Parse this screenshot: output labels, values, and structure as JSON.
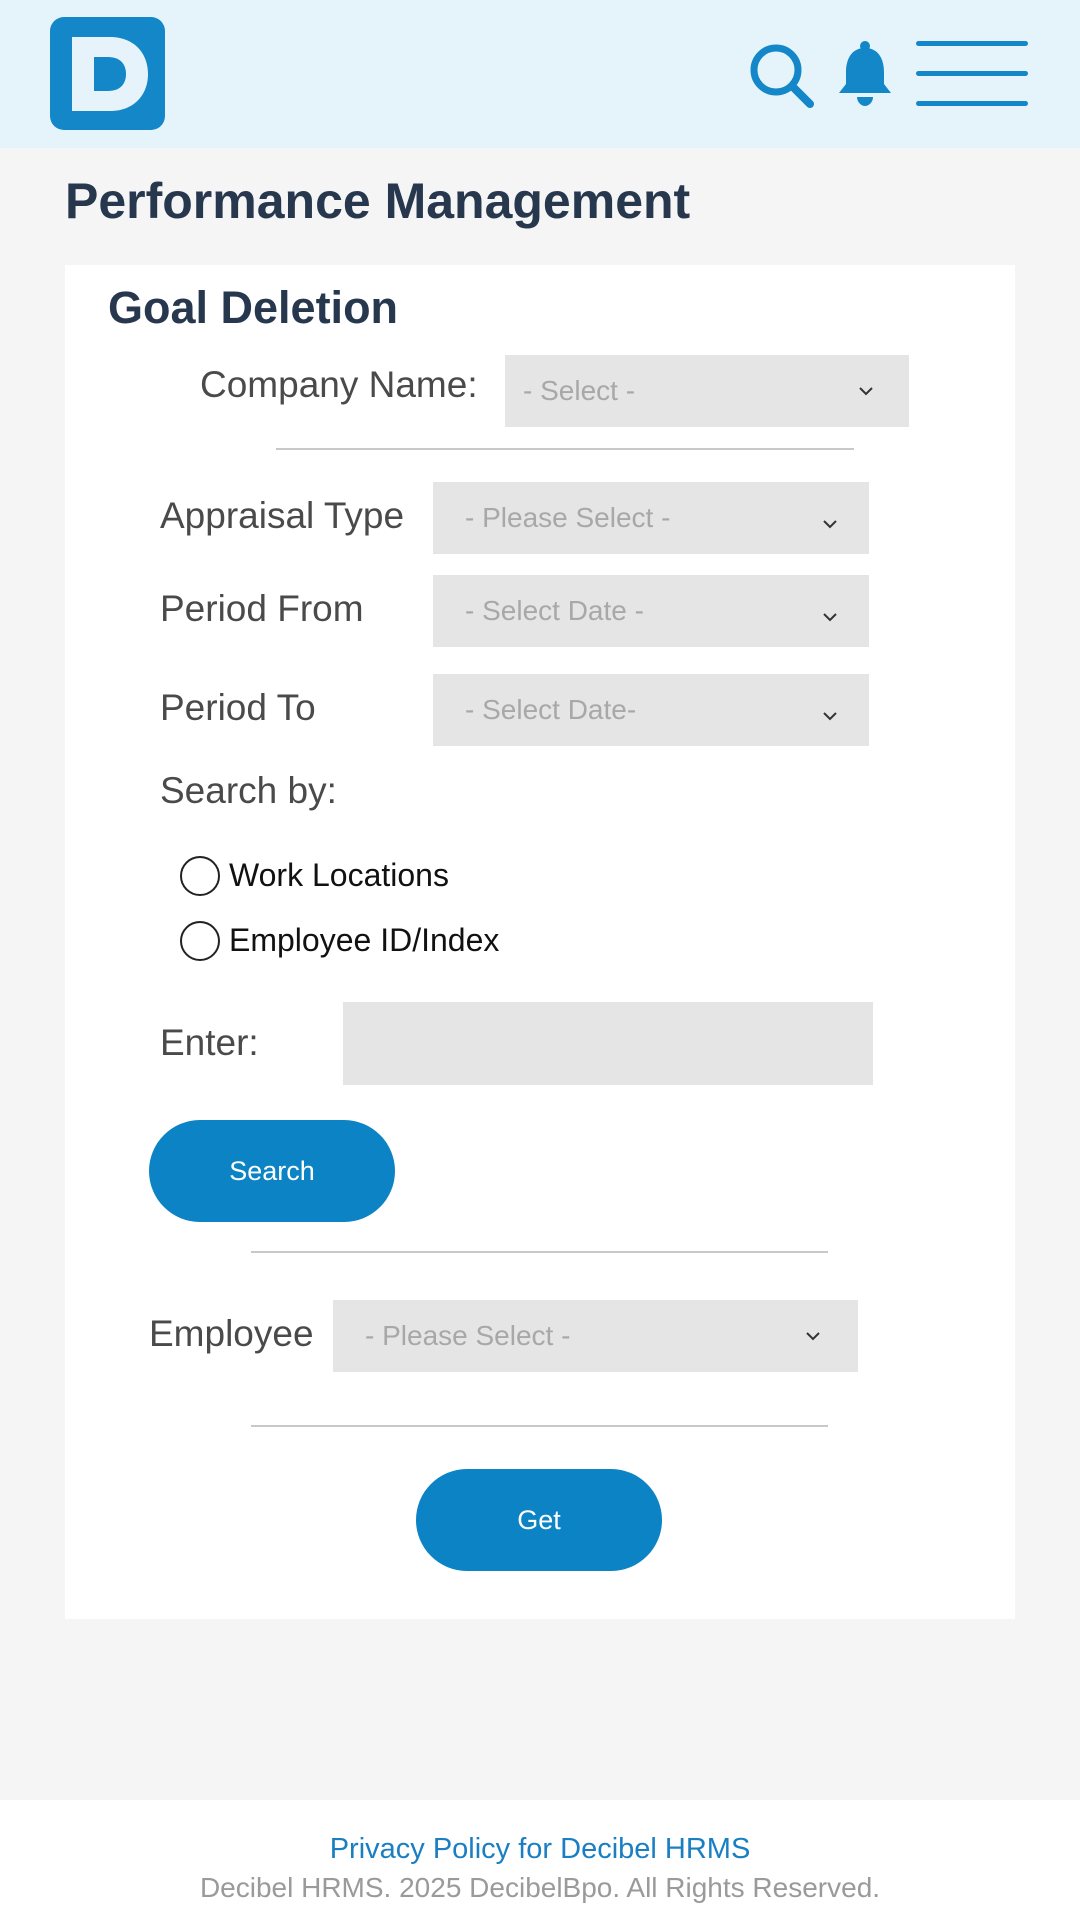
{
  "header": {
    "logo_letter": "D",
    "icons": {
      "logo": "decibel-logo",
      "search": "search-icon",
      "notifications": "bell-icon",
      "menu": "hamburger-menu-icon"
    },
    "accent_color": "#1387c8",
    "background_color": "#e5f3fb"
  },
  "page": {
    "title": "Performance Management"
  },
  "form": {
    "section_title": "Goal Deletion",
    "company": {
      "label": "Company Name:",
      "value": "- Select -"
    },
    "appraisal_type": {
      "label": "Appraisal Type",
      "value": "- Please Select -"
    },
    "period_from": {
      "label": "Period From",
      "value": "- Select Date -"
    },
    "period_to": {
      "label": "Period To",
      "value": "- Select Date-"
    },
    "search_by": {
      "label": "Search by:",
      "options": [
        "Work Locations",
        "Employee ID/Index"
      ],
      "selected": null
    },
    "enter": {
      "label": "Enter:",
      "value": ""
    },
    "search_button": "Search",
    "employee": {
      "label": "Employee",
      "value": "- Please Select -"
    },
    "get_button": "Get"
  },
  "footer": {
    "privacy_link": "Privacy Policy for Decibel HRMS",
    "copyright": "Decibel HRMS. 2025 DecibelBpo. All Rights Reserved."
  }
}
